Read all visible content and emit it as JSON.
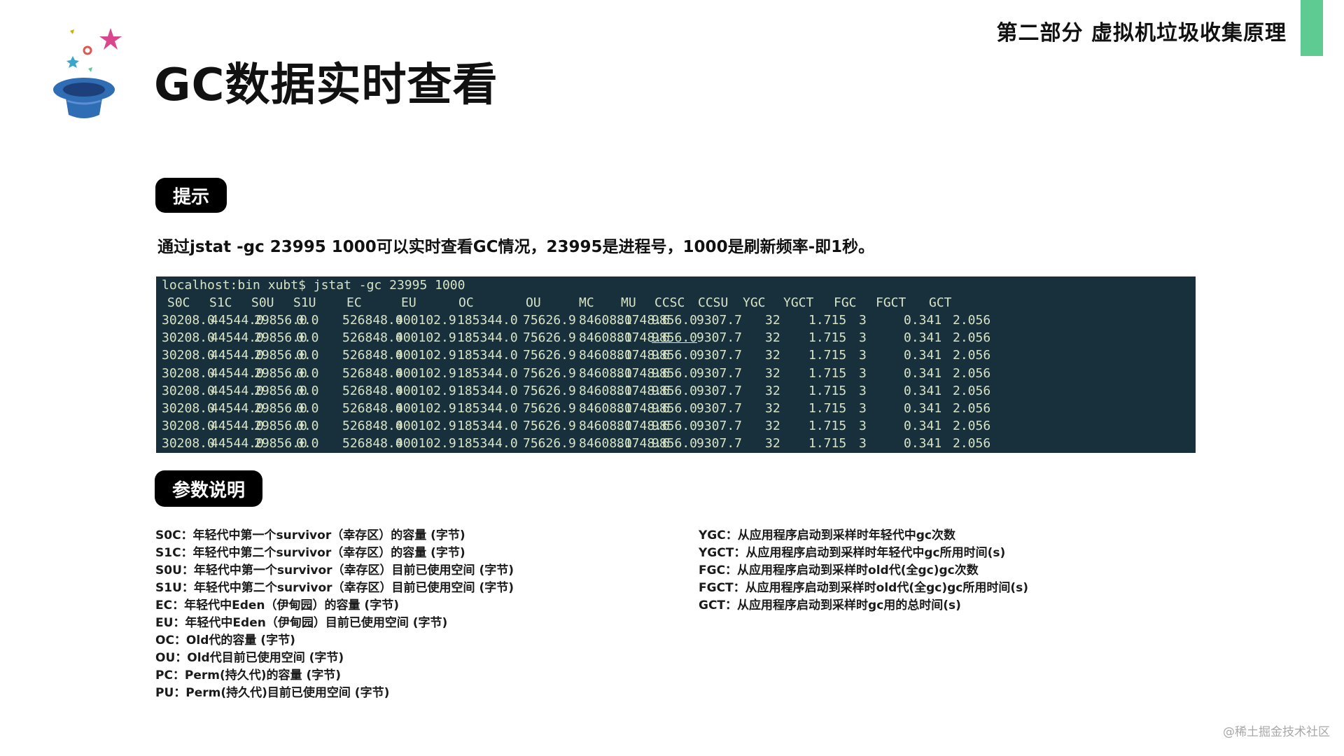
{
  "section_header": "第二部分 虚拟机垃圾收集原理",
  "page_title": "GC数据实时查看",
  "tip": {
    "label": "提示",
    "text": "通过jstat -gc 23995 1000可以实时查看GC情况，23995是进程号，1000是刷新频率-即1秒。"
  },
  "terminal": {
    "prompt": "localhost:bin xubt$ jstat -gc 23995 1000",
    "columns": [
      "S0C",
      "S1C",
      "S0U",
      "S1U",
      "EC",
      "EU",
      "OC",
      "OU",
      "MC",
      "MU",
      "CCSC",
      "CCSU",
      "YGC",
      "YGCT",
      "FGC",
      "FGCT",
      "GCT"
    ],
    "rows": [
      [
        "30208.0",
        "44544.0",
        "29856.0",
        "0.0",
        "526848.0",
        "400102.9",
        "185344.0",
        "75626.9",
        "84608.0",
        "81748.6",
        "9856.0",
        "9307.7",
        "32",
        "1.715",
        "3",
        "0.341",
        "2.056"
      ],
      [
        "30208.0",
        "44544.0",
        "29856.0",
        "0.0",
        "526848.0",
        "400102.9",
        "185344.0",
        "75626.9",
        "84608.0",
        "81748.6",
        "9856.0",
        "9307.7",
        "32",
        "1.715",
        "3",
        "0.341",
        "2.056"
      ],
      [
        "30208.0",
        "44544.0",
        "29856.0",
        "0.0",
        "526848.0",
        "400102.9",
        "185344.0",
        "75626.9",
        "84608.0",
        "81748.6",
        "9856.0",
        "9307.7",
        "32",
        "1.715",
        "3",
        "0.341",
        "2.056"
      ],
      [
        "30208.0",
        "44544.0",
        "29856.0",
        "0.0",
        "526848.0",
        "400102.9",
        "185344.0",
        "75626.9",
        "84608.0",
        "81748.6",
        "9856.0",
        "9307.7",
        "32",
        "1.715",
        "3",
        "0.341",
        "2.056"
      ],
      [
        "30208.0",
        "44544.0",
        "29856.0",
        "0.0",
        "526848.0",
        "400102.9",
        "185344.0",
        "75626.9",
        "84608.0",
        "81748.6",
        "9856.0",
        "9307.7",
        "32",
        "1.715",
        "3",
        "0.341",
        "2.056"
      ],
      [
        "30208.0",
        "44544.0",
        "29856.0",
        "0.0",
        "526848.0",
        "400102.9",
        "185344.0",
        "75626.9",
        "84608.0",
        "81748.6",
        "9856.0",
        "9307.7",
        "32",
        "1.715",
        "3",
        "0.341",
        "2.056"
      ],
      [
        "30208.0",
        "44544.0",
        "29856.0",
        "0.0",
        "526848.0",
        "400102.9",
        "185344.0",
        "75626.9",
        "84608.0",
        "81748.6",
        "9856.0",
        "9307.7",
        "32",
        "1.715",
        "3",
        "0.341",
        "2.056"
      ],
      [
        "30208.0",
        "44544.0",
        "29856.0",
        "0.0",
        "526848.0",
        "400102.9",
        "185344.0",
        "75626.9",
        "84608.0",
        "81748.6",
        "9856.0",
        "9307.7",
        "32",
        "1.715",
        "3",
        "0.341",
        "2.056"
      ]
    ]
  },
  "params": {
    "label": "参数说明",
    "left": [
      "S0C：年轻代中第一个survivor（幸存区）的容量 (字节)",
      "S1C：年轻代中第二个survivor（幸存区）的容量 (字节)",
      "S0U：年轻代中第一个survivor（幸存区）目前已使用空间 (字节)",
      "S1U：年轻代中第二个survivor（幸存区）目前已使用空间 (字节)",
      "EC：年轻代中Eden（伊甸园）的容量 (字节)",
      "EU：年轻代中Eden（伊甸园）目前已使用空间 (字节)",
      "OC：Old代的容量 (字节)",
      "OU：Old代目前已使用空间 (字节)",
      "PC：Perm(持久代)的容量 (字节)",
      "PU：Perm(持久代)目前已使用空间 (字节)"
    ],
    "right": [
      "YGC：从应用程序启动到采样时年轻代中gc次数",
      "YGCT：从应用程序启动到采样时年轻代中gc所用时间(s)",
      "FGC：从应用程序启动到采样时old代(全gc)gc次数",
      "FGCT：从应用程序启动到采样时old代(全gc)gc所用时间(s)",
      "GCT：从应用程序启动到采样时gc用的总时间(s)"
    ]
  },
  "watermark": "@稀土掘金技术社区",
  "colors": {
    "accent": "#5ecb93",
    "terminal_bg": "#17303b",
    "terminal_text": "#d8e3c6",
    "pill_bg": "#000000"
  },
  "icons": [
    "magic-hat-logo"
  ]
}
